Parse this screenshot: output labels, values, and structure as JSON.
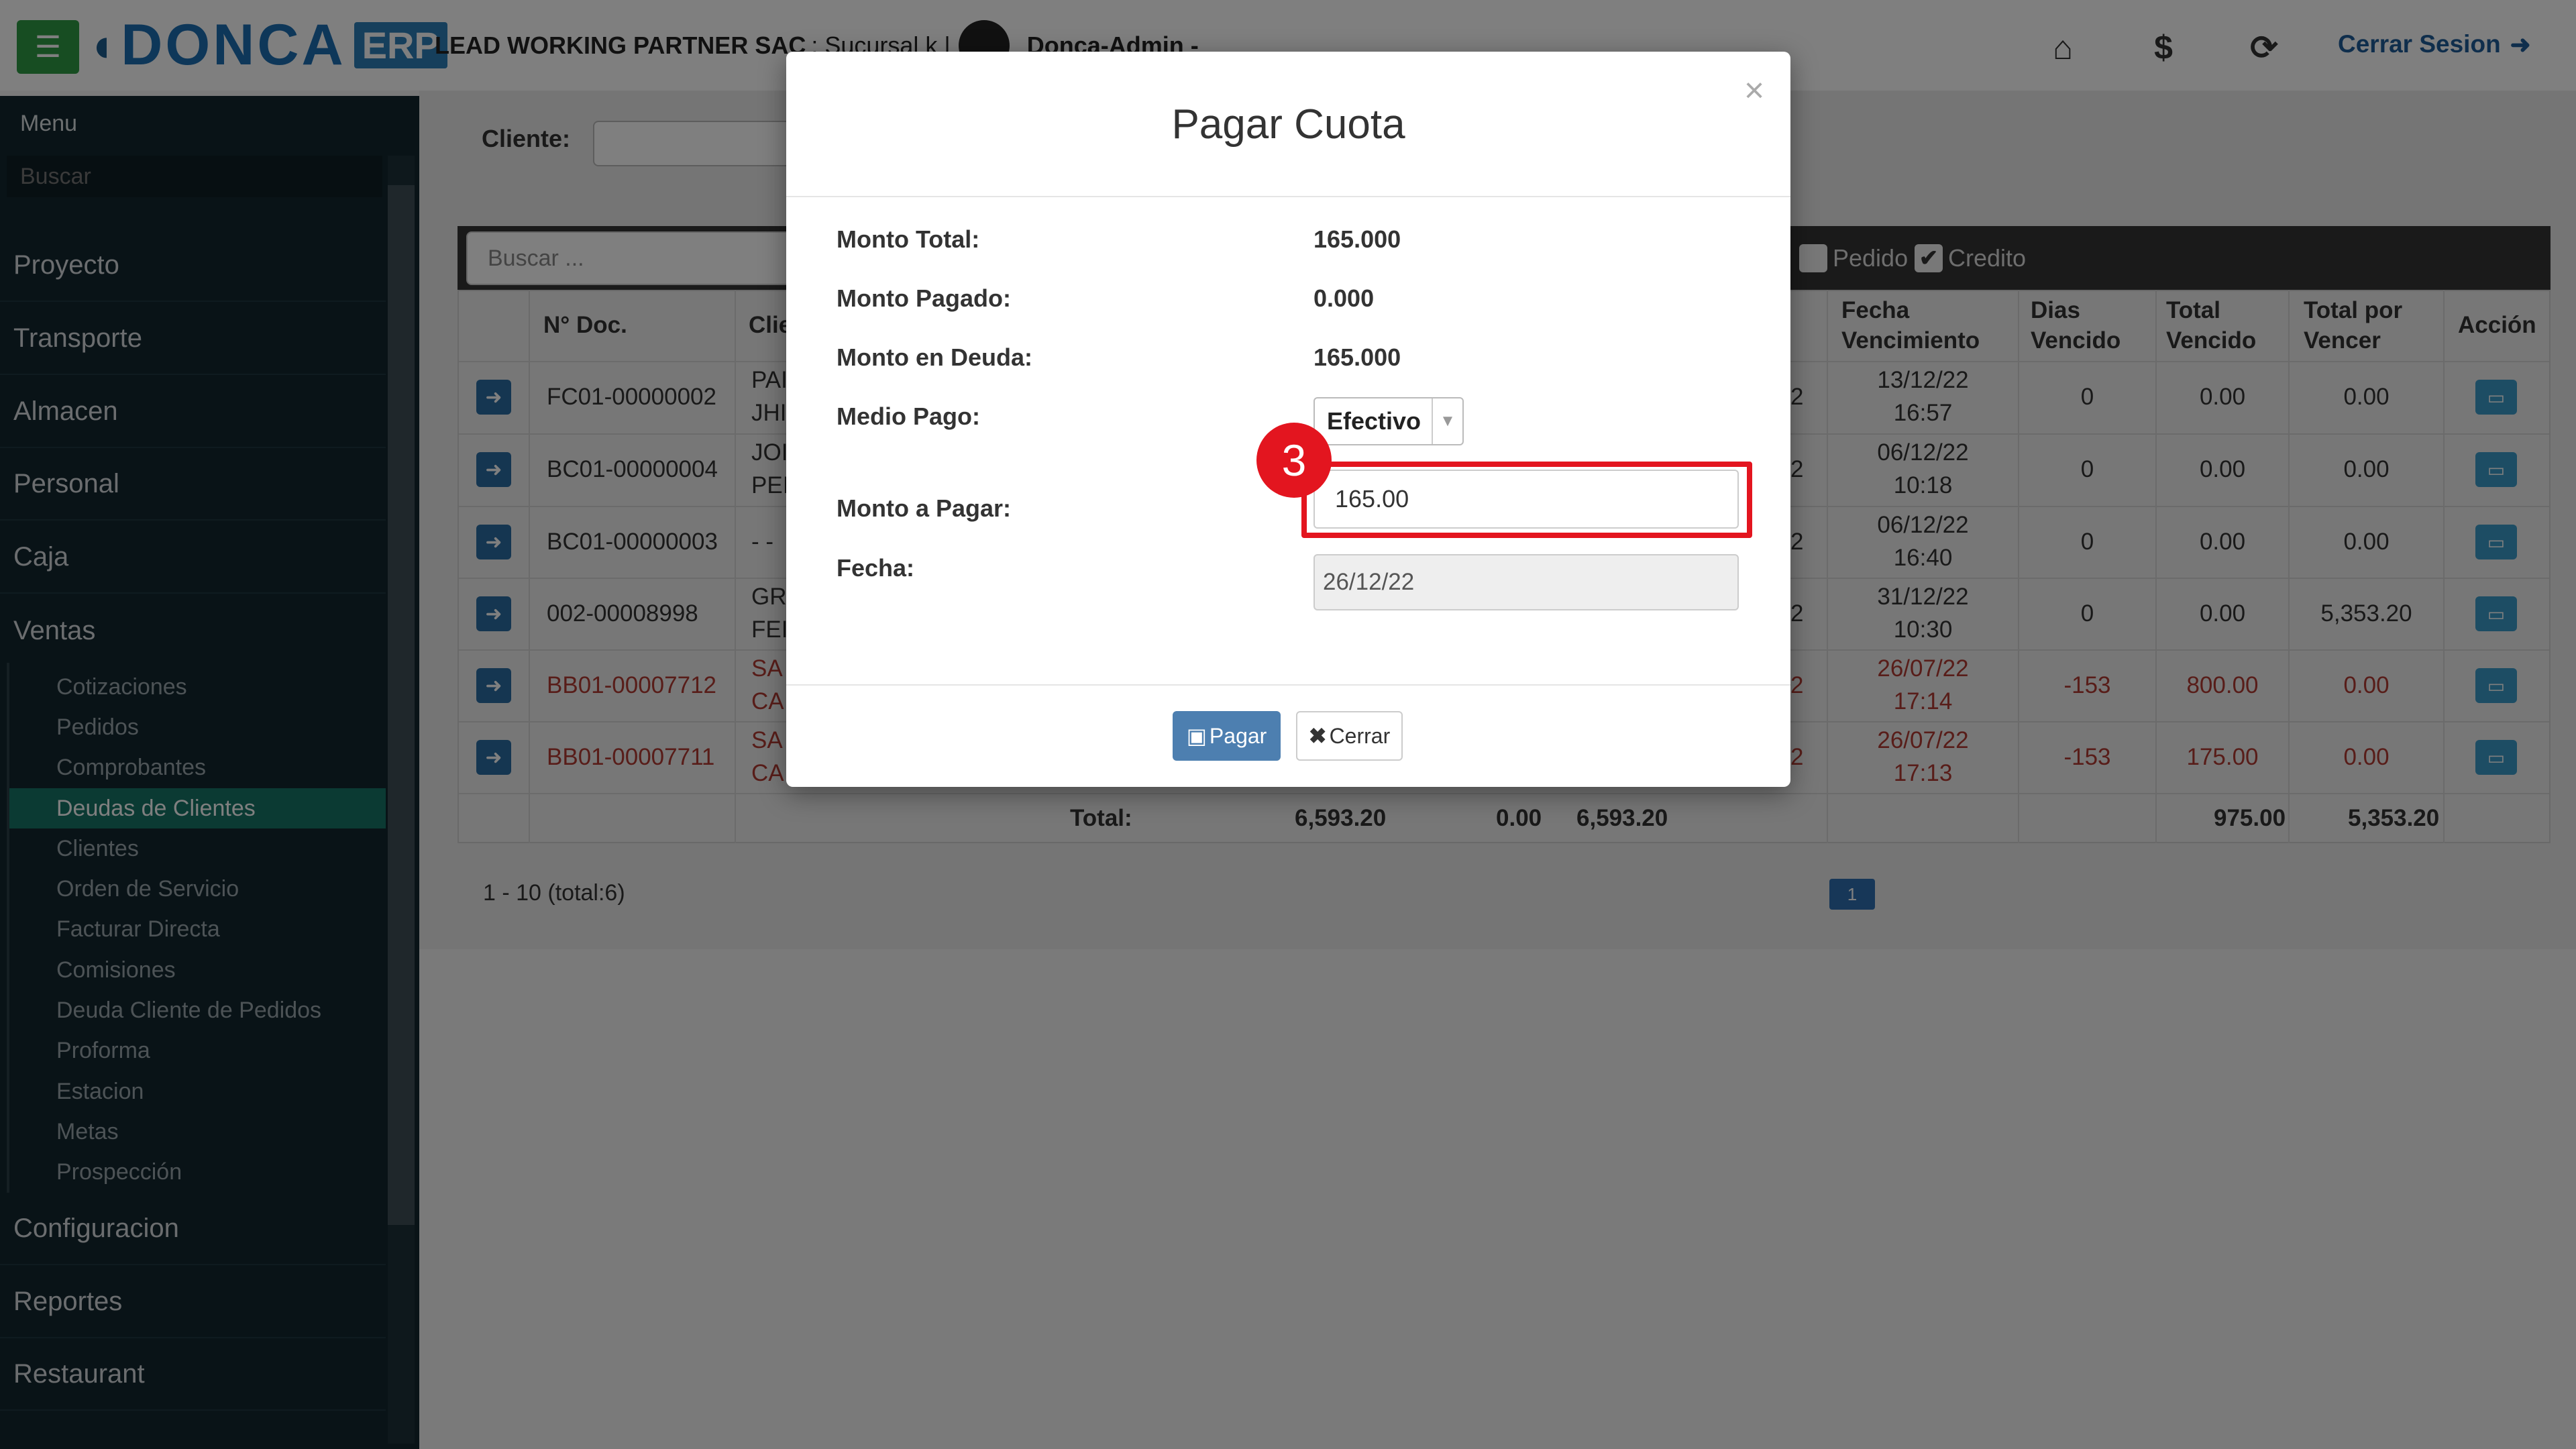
{
  "header": {
    "brand": "DONCA",
    "brand_suffix": "ERP",
    "company": "LEAD WORKING PARTNER SAC",
    "branch": ": Sucursal k |",
    "user": "Donca-Admin -",
    "logout_label": "Cerrar Sesion",
    "icons": [
      "menu-icon",
      "home-icon",
      "dollar-icon",
      "lock-cycle-icon",
      "logout-icon"
    ]
  },
  "sidebar": {
    "title": "Menu",
    "search_placeholder": "Buscar",
    "items": [
      "Proyecto",
      "Transporte",
      "Almacen",
      "Personal",
      "Caja",
      "Ventas",
      "Configuracion",
      "Reportes",
      "Restaurant"
    ],
    "ventas_subitems": [
      "Cotizaciones",
      "Pedidos",
      "Comprobantes",
      "Deudas de Clientes",
      "Clientes",
      "Orden de Servicio",
      "Facturar Directa",
      "Comisiones",
      "Deuda Cliente de Pedidos",
      "Proforma",
      "Estacion",
      "Metas",
      "Prospección"
    ],
    "active_subitem": "Deudas de Clientes"
  },
  "filters": {
    "cliente_label": "Cliente:",
    "table_search_placeholder": "Buscar ...",
    "pedido_label": "Pedido",
    "credito_label": "Credito"
  },
  "table": {
    "headers": {
      "doc": "N° Doc.",
      "cliente": "Clie",
      "fecha_venc_1": "Fecha",
      "fecha_venc_2": "Vencimiento",
      "dias_venc_1": "Dias",
      "dias_venc_2": "Vencido",
      "total_venc_1": "Total",
      "total_venc_2": "Vencido",
      "total_vencer_1": "Total por",
      "total_vencer_2": "Vencer",
      "accion": "Acción"
    },
    "rows": [
      {
        "doc": "FC01-00000002",
        "cli1": "PAI",
        "cli2": "JHI",
        "hidden": "2",
        "fecha1": "13/12/22",
        "fecha2": "16:57",
        "dias": "0",
        "tv": "0.00",
        "tpv": "0.00"
      },
      {
        "doc": "BC01-00000004",
        "cli1": "JOI",
        "cli2": "PEI",
        "hidden": "2",
        "fecha1": "06/12/22",
        "fecha2": "10:18",
        "dias": "0",
        "tv": "0.00",
        "tpv": "0.00"
      },
      {
        "doc": "BC01-00000003",
        "cli1": "- -",
        "cli2": "",
        "hidden": "2",
        "fecha1": "06/12/22",
        "fecha2": "16:40",
        "dias": "0",
        "tv": "0.00",
        "tpv": "0.00"
      },
      {
        "doc": "002-00008998",
        "cli1": "GR",
        "cli2": "FEI",
        "hidden": "2",
        "fecha1": "31/12/22",
        "fecha2": "10:30",
        "dias": "0",
        "tv": "0.00",
        "tpv": "5,353.20"
      },
      {
        "doc": "BB01-00007712",
        "cli1": "SA",
        "cli2": "CA",
        "hidden": "2",
        "fecha1": "26/07/22",
        "fecha2": "17:14",
        "dias": "-153",
        "tv": "800.00",
        "tpv": "0.00"
      },
      {
        "doc": "BB01-00007711",
        "cli1": "SA",
        "cli2": "CA",
        "hidden": "2",
        "fecha1": "26/07/22",
        "fecha2": "17:13",
        "dias": "-153",
        "tv": "175.00",
        "tpv": "0.00"
      }
    ],
    "totals": {
      "label": "Total:",
      "t1": "6,593.20",
      "t2": "0.00",
      "t3": "6,593.20",
      "tv": "975.00",
      "tpv": "5,353.20"
    },
    "pager_info": "1 - 10 (total:6)",
    "page": "1"
  },
  "modal": {
    "title": "Pagar Cuota",
    "close": "×",
    "monto_total_label": "Monto Total:",
    "monto_total": "165.000",
    "monto_pagado_label": "Monto Pagado:",
    "monto_pagado": "0.000",
    "monto_deuda_label": "Monto en Deuda:",
    "monto_deuda": "165.000",
    "medio_pago_label": "Medio Pago:",
    "medio_pago": "Efectivo",
    "monto_pagar_label": "Monto a Pagar:",
    "monto_pagar": "165.00",
    "fecha_label": "Fecha:",
    "fecha": "26/12/22",
    "pagar_label": "Pagar",
    "cerrar_label": "Cerrar",
    "step_badge": "3"
  },
  "colors": {
    "accent": "#1d6fb3",
    "sidebar": "#13272f",
    "active": "#167567",
    "highlight": "#e3151f"
  }
}
